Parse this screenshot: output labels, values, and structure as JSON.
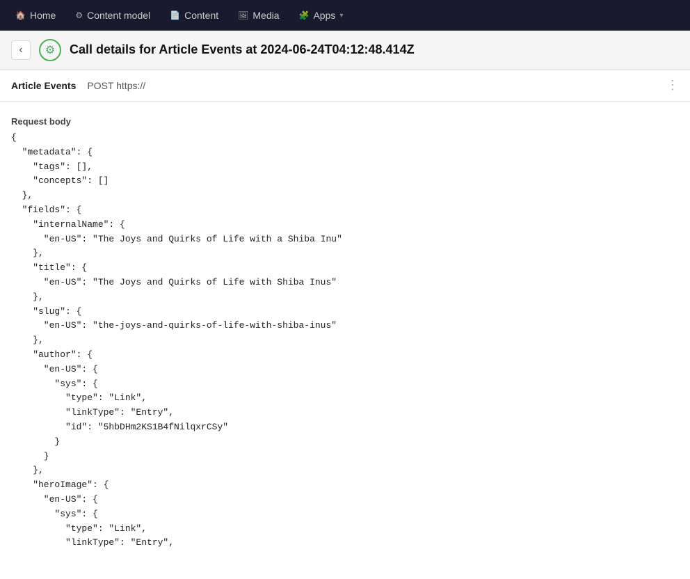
{
  "topnav": {
    "items": [
      {
        "label": "Home",
        "icon": "🏠"
      },
      {
        "label": "Content model",
        "icon": "⚙"
      },
      {
        "label": "Content",
        "icon": "📄"
      },
      {
        "label": "Media",
        "icon": "🖼"
      },
      {
        "label": "Apps",
        "icon": "🧩",
        "hasDropdown": true
      }
    ]
  },
  "header": {
    "title": "Call details for Article Events at 2024-06-24T04:12:48.414Z",
    "gear_icon": "⚙",
    "back_label": "‹"
  },
  "info_bar": {
    "event_name": "Article Events",
    "method_url": "POST https://"
  },
  "section": {
    "label": "Request body"
  },
  "code": {
    "content": "{\n  \"metadata\": {\n    \"tags\": [],\n    \"concepts\": []\n  },\n  \"fields\": {\n    \"internalName\": {\n      \"en-US\": \"The Joys and Quirks of Life with a Shiba Inu\"\n    },\n    \"title\": {\n      \"en-US\": \"The Joys and Quirks of Life with Shiba Inus\"\n    },\n    \"slug\": {\n      \"en-US\": \"the-joys-and-quirks-of-life-with-shiba-inus\"\n    },\n    \"author\": {\n      \"en-US\": {\n        \"sys\": {\n          \"type\": \"Link\",\n          \"linkType\": \"Entry\",\n          \"id\": \"5hbDHm2KS1B4fNilqxrCSy\"\n        }\n      }\n    },\n    \"heroImage\": {\n      \"en-US\": {\n        \"sys\": {\n          \"type\": \"Link\",\n          \"linkType\": \"Entry\","
  },
  "icons": {
    "back": "‹",
    "gear": "⚙",
    "more": "⋮"
  }
}
